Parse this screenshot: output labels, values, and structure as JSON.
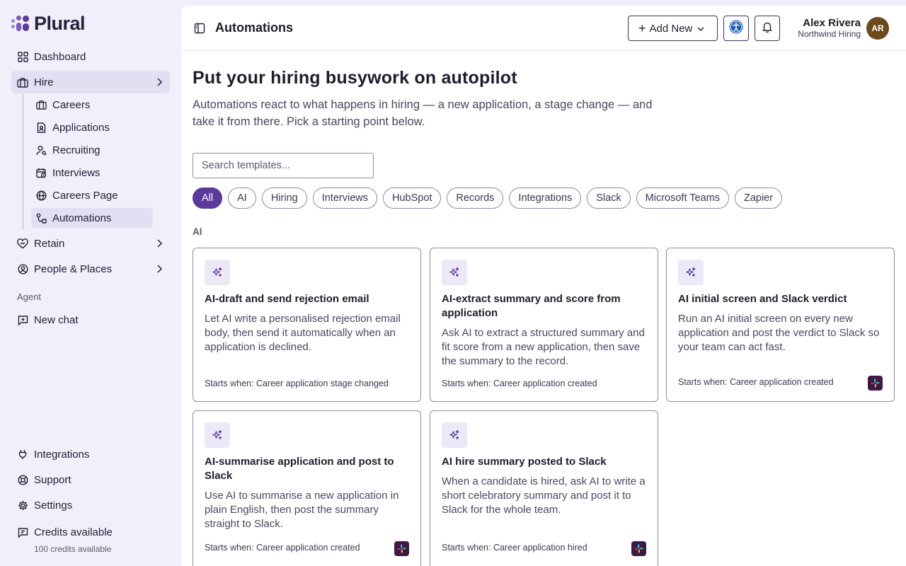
{
  "brand": {
    "name": "Plural"
  },
  "sidebar": {
    "items": [
      {
        "label": "Dashboard",
        "icon": "dashboard-grid-icon"
      },
      {
        "label": "Hire",
        "icon": "briefcase-icon"
      },
      {
        "label": "Retain",
        "icon": "heart-hand-icon"
      },
      {
        "label": "People & Places",
        "icon": "user-circle-icon"
      }
    ],
    "hire_subitems": [
      {
        "label": "Careers",
        "icon": "briefcase-icon"
      },
      {
        "label": "Applications",
        "icon": "document-user-icon"
      },
      {
        "label": "Recruiting",
        "icon": "user-search-icon"
      },
      {
        "label": "Interviews",
        "icon": "calendar-clock-icon"
      },
      {
        "label": "Careers Page",
        "icon": "globe-icon"
      },
      {
        "label": "Automations",
        "icon": "workflow-icon"
      }
    ],
    "agent_section_label": "Agent",
    "new_chat_label": "New chat",
    "bottom_items": [
      {
        "label": "Integrations",
        "icon": "plug-icon"
      },
      {
        "label": "Support",
        "icon": "lifebuoy-icon"
      },
      {
        "label": "Settings",
        "icon": "gear-icon"
      }
    ],
    "credits": {
      "label": "Credits available",
      "sub": "100 credits available"
    }
  },
  "header": {
    "title": "Automations",
    "add_new_label": "Add New",
    "user": {
      "name": "Alex Rivera",
      "org": "Northwind Hiring",
      "initials": "AR"
    }
  },
  "main": {
    "hero_title": "Put your hiring busywork on autopilot",
    "hero_desc": "Automations react to what happens in hiring — a new application, a stage change — and take it from there. Pick a starting point below.",
    "search_placeholder": "Search templates...",
    "filters": [
      "All",
      "AI",
      "Hiring",
      "Interviews",
      "HubSpot",
      "Records",
      "Integrations",
      "Slack",
      "Microsoft Teams",
      "Zapier"
    ],
    "active_filter": "All",
    "group_label": "AI",
    "cards": [
      {
        "title": "AI-draft and send rejection email",
        "description": "Let AI write a personalised rejection email body, then send it automatically when an application is declined.",
        "trigger": "Starts when: Career application stage changed",
        "slack": false
      },
      {
        "title": "AI-extract summary and score from application",
        "description": "Ask AI to extract a structured summary and fit score from a new application, then save the summary to the record.",
        "trigger": "Starts when: Career application created",
        "slack": false
      },
      {
        "title": "AI initial screen and Slack verdict",
        "description": "Run an AI initial screen on every new application and post the verdict to Slack so your team can act fast.",
        "trigger": "Starts when: Career application created",
        "slack": true
      },
      {
        "title": "AI-summarise application and post to Slack",
        "description": "Use AI to summarise a new application in plain English, then post the summary straight to Slack.",
        "trigger": "Starts when: Career application created",
        "slack": true
      },
      {
        "title": "AI hire summary posted to Slack",
        "description": "When a candidate is hired, ask AI to write a short celebratory summary and post it to Slack for the whole team.",
        "trigger": "Starts when: Career application hired",
        "slack": true
      }
    ]
  },
  "colors": {
    "accent": "#5b3a9a",
    "sidebar_bg": "#f1eff9",
    "active_bg": "#e3dff2",
    "slack_bg": "#3d1a44"
  }
}
